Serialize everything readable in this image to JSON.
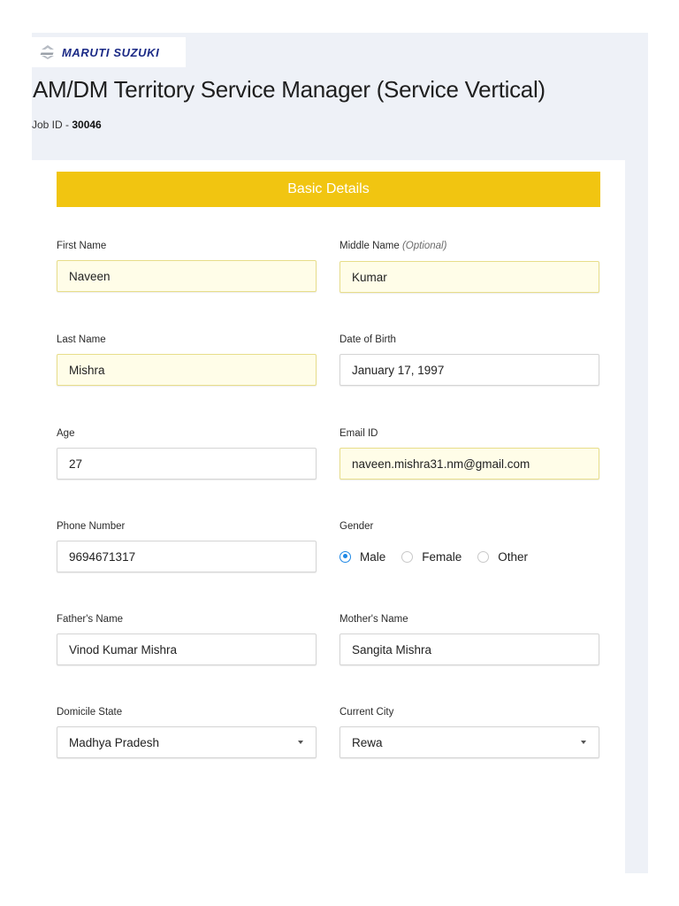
{
  "brand": {
    "name": "MARUTI SUZUKI",
    "logo_icon": "suzuki-s-logo-icon",
    "color": "#1b2a86"
  },
  "job": {
    "title": "AM/DM Territory Service Manager (Service Vertical)",
    "id_label": "Job ID - ",
    "id_value": "30046"
  },
  "section": {
    "title": "Basic Details",
    "color": "#f1c511"
  },
  "fields": {
    "first_name": {
      "label": "First Name",
      "value": "Naveen"
    },
    "middle_name": {
      "label": "Middle Name",
      "optional_note": "(Optional)",
      "value": "Kumar"
    },
    "last_name": {
      "label": "Last Name",
      "value": "Mishra"
    },
    "dob": {
      "label": "Date of Birth",
      "value": "January 17, 1997"
    },
    "age": {
      "label": "Age",
      "value": "27"
    },
    "email": {
      "label": "Email ID",
      "value": "naveen.mishra31.nm@gmail.com"
    },
    "phone": {
      "label": "Phone Number",
      "value": "9694671317"
    },
    "gender": {
      "label": "Gender",
      "options": [
        "Male",
        "Female",
        "Other"
      ],
      "selected": "Male"
    },
    "father_name": {
      "label": "Father's Name",
      "value": "Vinod Kumar Mishra"
    },
    "mother_name": {
      "label": "Mother's Name",
      "value": "Sangita Mishra"
    },
    "domicile_state": {
      "label": "Domicile State",
      "value": "Madhya Pradesh"
    },
    "current_city": {
      "label": "Current City",
      "value": "Rewa"
    }
  },
  "icons": {
    "dropdown": "chevron-down-icon",
    "radio_selected_color": "#1e88e5"
  }
}
